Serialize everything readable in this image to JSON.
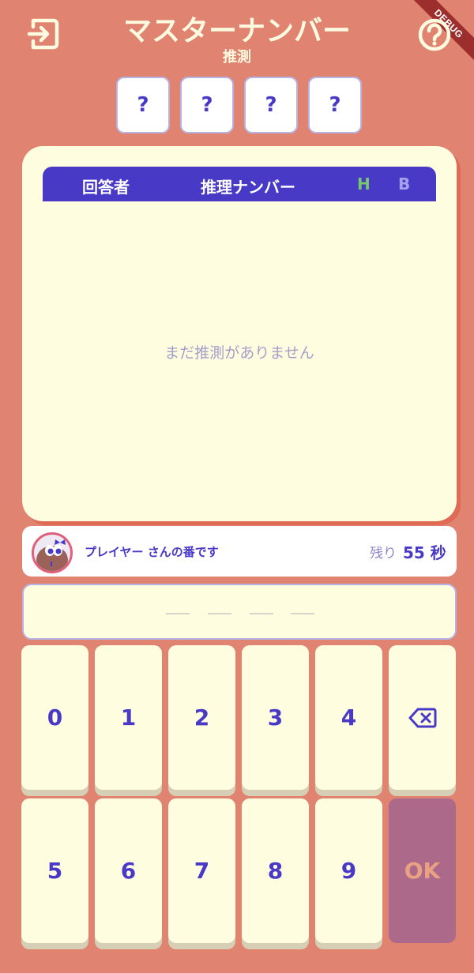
{
  "header": {
    "title": "マスターナンバー",
    "subtitle": "推測",
    "debug_label": "DEBUG",
    "exit_icon": "exit-icon",
    "help_icon": "help-icon"
  },
  "secret": [
    "?",
    "?",
    "?",
    "?"
  ],
  "history": {
    "columns": {
      "answerer": "回答者",
      "guess": "推理ナンバー",
      "hit": "H",
      "blow": "B"
    },
    "empty_message": "まだ推測がありません",
    "rows": []
  },
  "turn": {
    "message": "プレイヤー さんの番です",
    "remaining_label": "残り",
    "remaining_value": "55 秒"
  },
  "keypad": {
    "row1": [
      "0",
      "1",
      "2",
      "3",
      "4"
    ],
    "row2": [
      "5",
      "6",
      "7",
      "8",
      "9"
    ],
    "backspace_icon": "backspace-icon",
    "ok_label": "OK"
  },
  "colors": {
    "background": "#e08371",
    "accent": "#4939c7",
    "card": "#fffde0",
    "hit": "#77c86c",
    "blow": "#a7a1ef",
    "ok_button": "#ad6989"
  }
}
